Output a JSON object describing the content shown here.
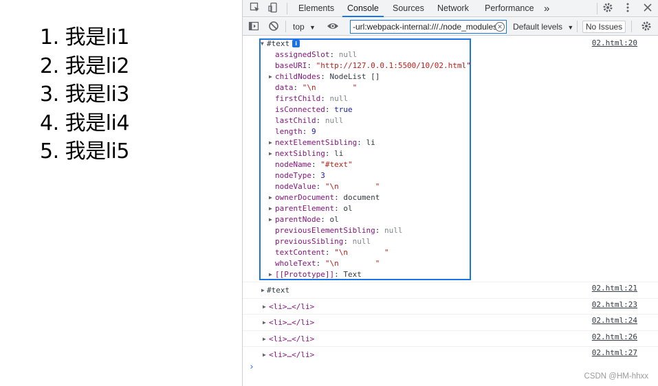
{
  "page": {
    "list_items": [
      "1. 我是li1",
      "2. 我是li2",
      "3. 我是li3",
      "4. 我是li4",
      "5. 我是li5"
    ]
  },
  "devtools": {
    "tabs": [
      "Elements",
      "Console",
      "Sources",
      "Network",
      "Performance"
    ],
    "active_tab": "Console",
    "more_tabs": "»",
    "context": "top",
    "filter_value": "-url:webpack-internal:///./node_modules",
    "levels_label": "Default levels",
    "issues_label": "No Issues"
  },
  "console": {
    "expanded": {
      "label": "#text",
      "source": "02.html:20",
      "props": [
        {
          "key": "assignedSlot",
          "value": "null",
          "type": "u",
          "expandable": false
        },
        {
          "key": "baseURI",
          "value": "\"http://127.0.0.1:5500/10/02.html\"",
          "type": "s",
          "expandable": false
        },
        {
          "key": "childNodes",
          "value": "NodeList []",
          "type": "p",
          "expandable": true
        },
        {
          "key": "data",
          "value": "\"\\n        \"",
          "type": "s",
          "expandable": false
        },
        {
          "key": "firstChild",
          "value": "null",
          "type": "u",
          "expandable": false
        },
        {
          "key": "isConnected",
          "value": "true",
          "type": "n",
          "expandable": false
        },
        {
          "key": "lastChild",
          "value": "null",
          "type": "u",
          "expandable": false
        },
        {
          "key": "length",
          "value": "9",
          "type": "n",
          "expandable": false
        },
        {
          "key": "nextElementSibling",
          "value": "li",
          "type": "p",
          "expandable": true
        },
        {
          "key": "nextSibling",
          "value": "li",
          "type": "p",
          "expandable": true
        },
        {
          "key": "nodeName",
          "value": "\"#text\"",
          "type": "s",
          "expandable": false
        },
        {
          "key": "nodeType",
          "value": "3",
          "type": "n",
          "expandable": false
        },
        {
          "key": "nodeValue",
          "value": "\"\\n        \"",
          "type": "s",
          "expandable": false
        },
        {
          "key": "ownerDocument",
          "value": "document",
          "type": "p",
          "expandable": true
        },
        {
          "key": "parentElement",
          "value": "ol",
          "type": "p",
          "expandable": true
        },
        {
          "key": "parentNode",
          "value": "ol",
          "type": "p",
          "expandable": true
        },
        {
          "key": "previousElementSibling",
          "value": "null",
          "type": "u",
          "expandable": false
        },
        {
          "key": "previousSibling",
          "value": "null",
          "type": "u",
          "expandable": false
        },
        {
          "key": "textContent",
          "value": "\"\\n        \"",
          "type": "s",
          "expandable": false
        },
        {
          "key": "wholeText",
          "value": "\"\\n        \"",
          "type": "s",
          "expandable": false
        },
        {
          "key": "[[Prototype]]",
          "value": "Text",
          "type": "p",
          "expandable": true
        }
      ]
    },
    "rows": [
      {
        "label": "#text",
        "source": "02.html:21",
        "is_tag": false
      },
      {
        "label": "<li>…</li>",
        "source": "02.html:23",
        "is_tag": true
      },
      {
        "label": "<li>…</li>",
        "source": "02.html:24",
        "is_tag": true
      },
      {
        "label": "<li>…</li>",
        "source": "02.html:26",
        "is_tag": true
      },
      {
        "label": "<li>…</li>",
        "source": "02.html:27",
        "is_tag": true
      }
    ],
    "prompt": "›"
  },
  "watermark": "CSDN @HM-hhxx"
}
